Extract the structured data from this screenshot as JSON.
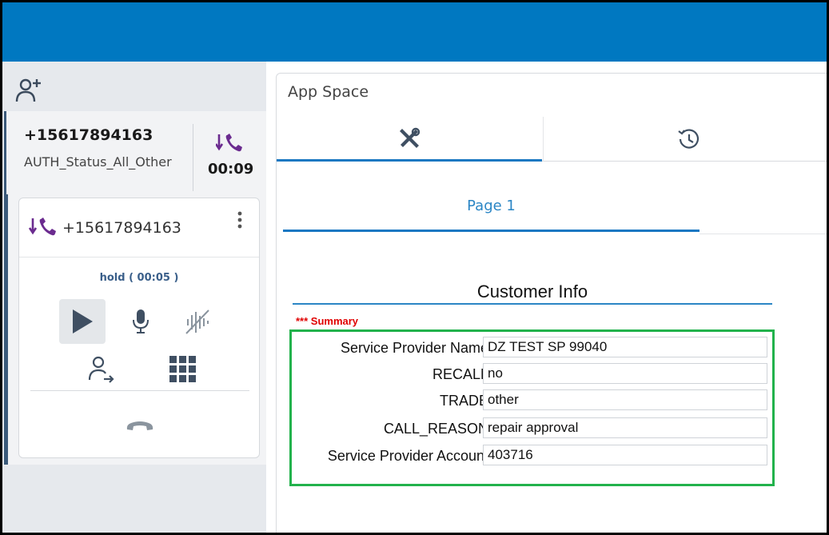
{
  "active_call": {
    "number": "+15617894163",
    "queue": "AUTH_Status_All_Other",
    "timer": "00:09"
  },
  "call_card": {
    "number": "+15617894163",
    "hold_status": "hold ( 00:05 )"
  },
  "app_space": {
    "title": "App Space",
    "page_tab": "Page 1"
  },
  "form": {
    "title": "Customer Info",
    "section_label": "*** Summary",
    "fields": [
      {
        "label": "Service Provider Name",
        "value": "DZ TEST SP 99040"
      },
      {
        "label": "RECALL",
        "value": "no"
      },
      {
        "label": "TRADE",
        "value": "other"
      },
      {
        "label": "CALL_REASON",
        "value": "repair approval"
      },
      {
        "label": "Service Provider Account",
        "value": "403716"
      }
    ]
  },
  "colors": {
    "topbar": "#0078c1",
    "accent": "#1a78c2",
    "call_icon": "#6b2b8f",
    "summary_border": "#22b24c",
    "summary_label": "#e00000"
  },
  "icons": {
    "add_contact": "add-user-icon",
    "inbound_call": "inbound-call-icon",
    "tools_tab": "tools-icon",
    "history_tab": "history-icon"
  }
}
